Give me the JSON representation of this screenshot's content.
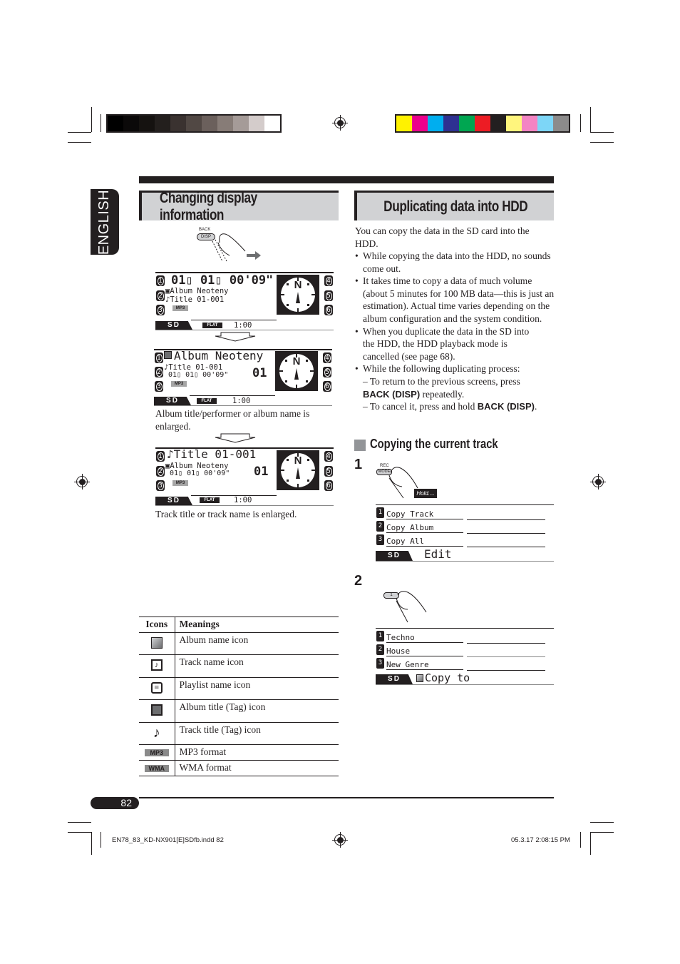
{
  "print_marks": {
    "gray_swatches": [
      "#000000",
      "#0b0909",
      "#151210",
      "#231f1d",
      "#3a3230",
      "#514844",
      "#6b605c",
      "#877c77",
      "#a59b98",
      "#d4cccb",
      "#ffffff"
    ],
    "color_swatches": [
      "#fff200",
      "#ec008c",
      "#00aeef",
      "#2e3192",
      "#00a651",
      "#ed1c24",
      "#231f20",
      "#fff57d",
      "#f384c3",
      "#7dd6f7",
      "#8c8b8b"
    ]
  },
  "language_tab": "ENGLISH",
  "left_section": {
    "title": "Changing display information",
    "button_label_top": "BACK",
    "button_label": "DISP",
    "screens": [
      {
        "line1": "01▯ 01▯ 00'09\"",
        "line2": "▣Album Neoteny",
        "line3": "♪Title 01-001",
        "format": "MP3",
        "source": "SD",
        "eq": "FLAT",
        "clock": "1:00",
        "presets_left": [
          "1",
          "2",
          "3"
        ],
        "presets_right": [
          "4",
          "5",
          "6"
        ],
        "compass": "N"
      },
      {
        "line1": "Album Neoteny",
        "line2": "♪Title 01-001",
        "line3": "01▯ 01▯ 00'09\"",
        "disc": "01",
        "format": "MP3",
        "source": "SD",
        "eq": "FLAT",
        "clock": "1:00",
        "compass": "N"
      },
      {
        "line1": "♪Title 01-001",
        "line2": "▣Album Neoteny",
        "line3": "01▯ 01▯ 00'09\"",
        "disc": "01",
        "format": "MP3",
        "source": "SD",
        "eq": "FLAT",
        "clock": "1:00",
        "compass": "N"
      }
    ],
    "caption_1": "Album title/performer or album name is enlarged.",
    "caption_2": "Track title or track name is enlarged.",
    "table": {
      "headers": [
        "Icons",
        "Meanings"
      ],
      "rows": [
        {
          "icon": "album-name-icon",
          "meaning": "Album name icon"
        },
        {
          "icon": "track-name-icon",
          "meaning": "Track name icon"
        },
        {
          "icon": "playlist-name-icon",
          "meaning": "Playlist name icon"
        },
        {
          "icon": "album-title-tag-icon",
          "meaning": "Album title (Tag) icon"
        },
        {
          "icon": "track-title-tag-icon",
          "meaning": "Track title (Tag) icon"
        },
        {
          "icon": "MP3",
          "meaning": "MP3 format"
        },
        {
          "icon": "WMA",
          "meaning": "WMA format"
        }
      ]
    }
  },
  "right_section": {
    "title": "Duplicating data into HDD",
    "intro": "You can copy the data in the SD card into the HDD.",
    "bullets": [
      "While copying the data into the HDD, no sounds come out.",
      "It takes time to copy a data of much volume (about 5 minutes for 100 MB data—this is just an estimation). Actual time varies depending on the album configuration and the system condition.",
      "When you duplicate the data in the SD into the HDD, the HDD playback mode is cancelled (see page 68).",
      "While the following duplicating process:"
    ],
    "sub_items": [
      {
        "pre": "– To return to the previous screens, press ",
        "key": "BACK (DISP)",
        "post": " repeatedly."
      },
      {
        "pre": "– To cancel it, press and hold ",
        "key": "BACK (DISP)",
        "post": "."
      }
    ],
    "subsection_title": "Copying the current track",
    "step1": {
      "number": "1",
      "button_top": "REC",
      "button": "MODE",
      "hold_label": "Hold....",
      "menu": [
        "Copy Track",
        "Copy Album",
        "Copy All"
      ],
      "source": "SD",
      "screen_title": "Edit"
    },
    "step2": {
      "number": "2",
      "button": "1",
      "menu": [
        "Techno",
        "House",
        "New Genre"
      ],
      "source": "SD",
      "screen_title": "Copy to"
    }
  },
  "footer": {
    "page_number": "82",
    "file_slug": "EN78_83_KD-NX901[E]SDfb.indd   82",
    "timestamp": "05.3.17   2:08:15 PM"
  }
}
